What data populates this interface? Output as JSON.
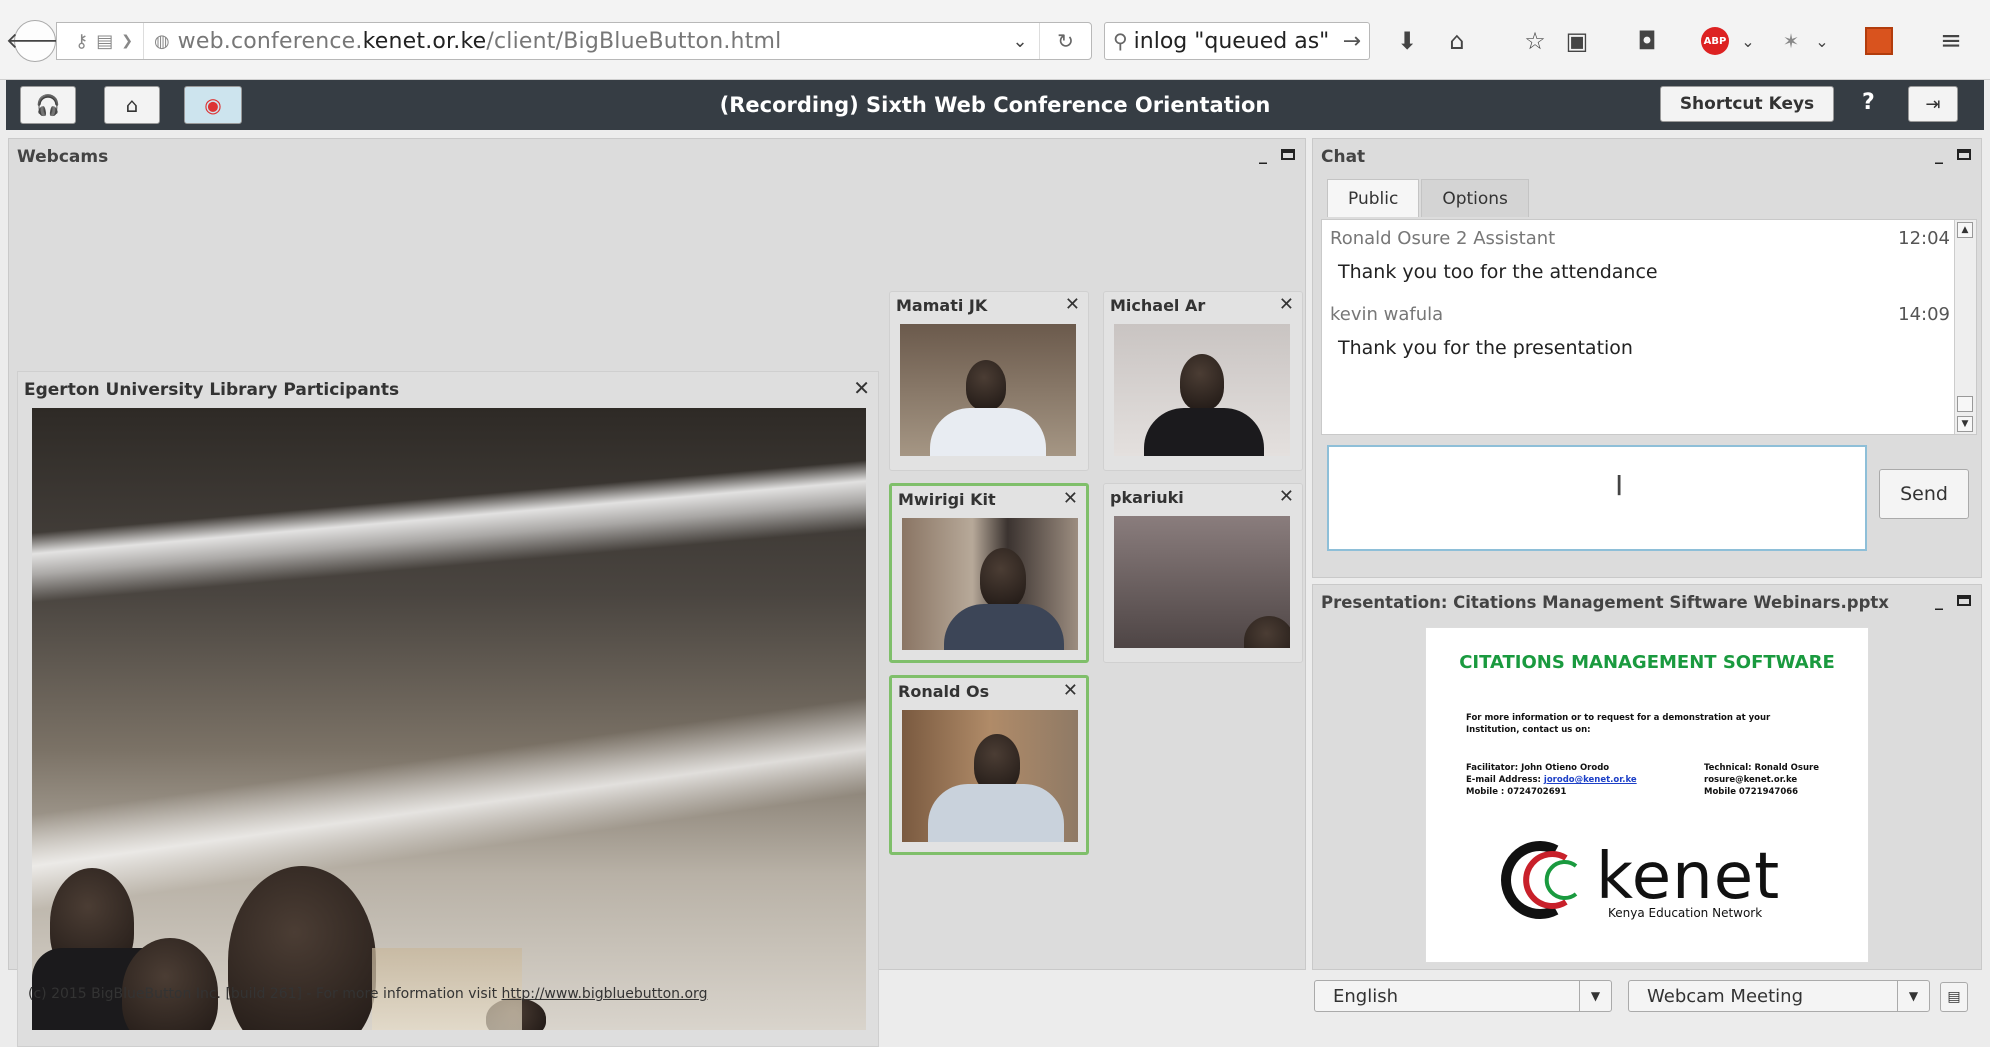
{
  "browser": {
    "url_prefix": "web.conference.",
    "url_domain": "kenet.or.ke",
    "url_path": "/client/BigBlueButton.html",
    "search_value": "inlog \"queued as\""
  },
  "bbb": {
    "title": "(Recording) Sixth Web Conference Orientation",
    "shortcut_keys": "Shortcut Keys",
    "help": "?"
  },
  "webcams": {
    "title": "Webcams",
    "main_label": "Egerton University Library Participants",
    "close": "✕",
    "cams": [
      {
        "name": "Mamati JK"
      },
      {
        "name": "Michael Ar"
      },
      {
        "name": "Mwirigi Kit"
      },
      {
        "name": "pkariuki"
      },
      {
        "name": "Ronald Os"
      }
    ]
  },
  "chat": {
    "title": "Chat",
    "tabs": [
      "Public",
      "Options"
    ],
    "messages": [
      {
        "sender": "Ronald Osure 2 Assistant",
        "time": "12:04",
        "text": "Thank you too for the attendance"
      },
      {
        "sender": "kevin wafula",
        "time": "14:09",
        "text": "Thank you for the presentation"
      }
    ],
    "send": "Send"
  },
  "presentation": {
    "title": "Presentation: Citations Management Siftware Webinars.pptx",
    "slide_title": "CITATIONS MANAGEMENT SOFTWARE",
    "slide_intro_1": "For more information or to request for a demonstration at your",
    "slide_intro_2": "Institution, contact us on:",
    "facilitator_1": "Facilitator: John Otieno Orodo",
    "facilitator_2_label": "E-mail Address: ",
    "facilitator_2_email": "jorodo@kenet.or.ke",
    "facilitator_3": "Mobile : 0724702691",
    "technical_1": "Technical: Ronald Osure",
    "technical_2": "rosure@kenet.or.ke",
    "technical_3": "Mobile 0721947066",
    "logo_word": "kenet",
    "logo_sub": "Kenya Education Network"
  },
  "footer": {
    "text": "(c) 2015 BigBlueButton Inc. [build 261] - For more information visit ",
    "link": "http://www.bigbluebutton.org",
    "language": "English",
    "layout": "Webcam Meeting"
  },
  "colors": {
    "bbb_bar": "#363d44",
    "slide_title": "#1a9a3f",
    "talking_border": "#7fbf6a"
  }
}
